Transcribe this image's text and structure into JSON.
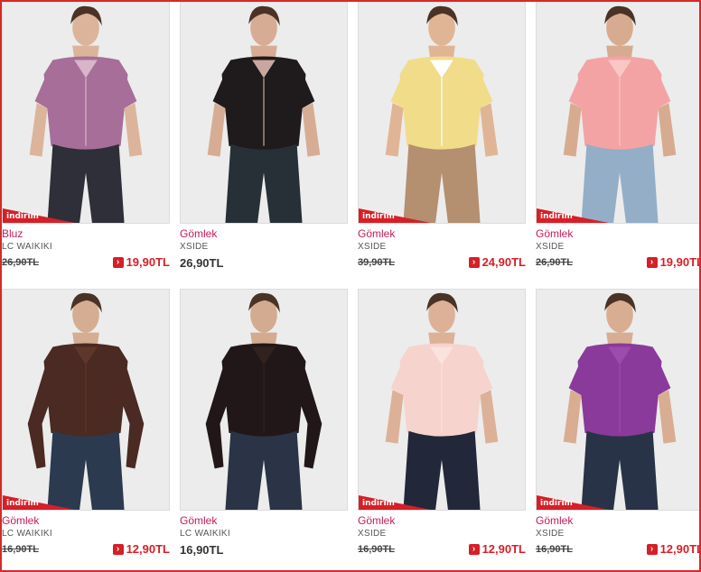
{
  "products": [
    {
      "category": "Bluz",
      "brand": "LC WAIKIKI",
      "old_price": "26,90TL",
      "new_price": "19,90TL",
      "badge": "indirim",
      "colors": {
        "top": "#a66e99",
        "top2": "#d8b5c8",
        "bottom": "#2e2f38",
        "skin": "#dcb49c"
      }
    },
    {
      "category": "Gömlek",
      "brand": "XSIDE",
      "old_price": "",
      "price": "26,90TL",
      "new_price": "",
      "badge": "",
      "colors": {
        "top": "#1f1a1c",
        "top2": "#c9a7a1",
        "bottom": "#263036",
        "skin": "#d6ad94"
      }
    },
    {
      "category": "Gömlek",
      "brand": "XSIDE",
      "old_price": "39,90TL",
      "new_price": "24,90TL",
      "badge": "indirim",
      "colors": {
        "top": "#f1dc8a",
        "top2": "#ffffff",
        "bottom": "#b48f70",
        "skin": "#e0b595"
      }
    },
    {
      "category": "Gömlek",
      "brand": "XSIDE",
      "old_price": "26,90TL",
      "new_price": "19,90TL",
      "badge": "indirim",
      "colors": {
        "top": "#f4a3a5",
        "top2": "#f9c7c4",
        "bottom": "#94aec8",
        "skin": "#d7ab90"
      }
    },
    {
      "category": "Gömlek",
      "brand": "LC WAIKIKI",
      "old_price": "16,90TL",
      "new_price": "12,90TL",
      "badge": "indirim",
      "colors": {
        "top": "#4a2a22",
        "top2": "#5e372c",
        "bottom": "#2c3a4f",
        "skin": "#d5ad92"
      }
    },
    {
      "category": "Gömlek",
      "brand": "LC WAIKIKI",
      "old_price": "",
      "price": "16,90TL",
      "new_price": "",
      "badge": "",
      "colors": {
        "top": "#221718",
        "top2": "#32221f",
        "bottom": "#2a3446",
        "skin": "#d3ab91"
      }
    },
    {
      "category": "Gömlek",
      "brand": "XSIDE",
      "old_price": "16,90TL",
      "new_price": "12,90TL",
      "badge": "indirim",
      "colors": {
        "top": "#f6d3cd",
        "top2": "#fae2dd",
        "bottom": "#22273a",
        "skin": "#dcb197"
      }
    },
    {
      "category": "Gömlek",
      "brand": "XSIDE",
      "old_price": "16,90TL",
      "new_price": "12,90TL",
      "badge": "indirim",
      "colors": {
        "top": "#8a3a9a",
        "top2": "#9d4bad",
        "bottom": "#283347",
        "skin": "#d9ad92"
      }
    }
  ],
  "accent_color": "#d61f26",
  "category_color": "#c41a5c",
  "arrow_icon": "chevron-right-icon"
}
